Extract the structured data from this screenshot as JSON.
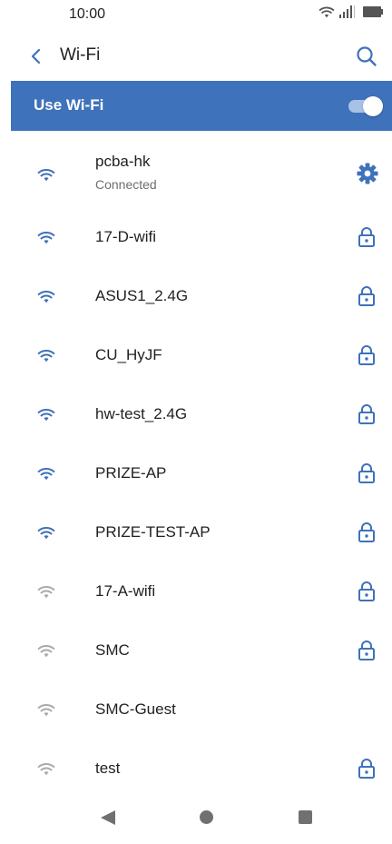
{
  "status_bar": {
    "time": "10:00"
  },
  "app_bar": {
    "title": "Wi-Fi",
    "back_icon": "back-arrow-icon",
    "search_icon": "search-icon"
  },
  "wifi_master": {
    "label": "Use Wi-Fi",
    "enabled": true,
    "bar_color": "#3e72bb"
  },
  "networks": [
    {
      "ssid": "pcba-hk",
      "status": "Connected",
      "signal": "strong",
      "trailing_icon": "gear-icon"
    },
    {
      "ssid": "17-D-wifi",
      "status": "",
      "signal": "strong",
      "trailing_icon": "lock-icon"
    },
    {
      "ssid": "ASUS1_2.4G",
      "status": "",
      "signal": "strong",
      "trailing_icon": "lock-icon"
    },
    {
      "ssid": "CU_HyJF",
      "status": "",
      "signal": "strong",
      "trailing_icon": "lock-icon"
    },
    {
      "ssid": "hw-test_2.4G",
      "status": "",
      "signal": "strong",
      "trailing_icon": "lock-icon"
    },
    {
      "ssid": "PRIZE-AP",
      "status": "",
      "signal": "strong",
      "trailing_icon": "lock-icon"
    },
    {
      "ssid": "PRIZE-TEST-AP",
      "status": "",
      "signal": "strong",
      "trailing_icon": "lock-icon"
    },
    {
      "ssid": "17-A-wifi",
      "status": "",
      "signal": "weak",
      "trailing_icon": "lock-icon"
    },
    {
      "ssid": "SMC",
      "status": "",
      "signal": "weak",
      "trailing_icon": "lock-icon"
    },
    {
      "ssid": "SMC-Guest",
      "status": "",
      "signal": "weak",
      "trailing_icon": ""
    },
    {
      "ssid": "test",
      "status": "",
      "signal": "weak",
      "trailing_icon": "lock-icon"
    }
  ],
  "colors": {
    "accent": "#3e72bb",
    "wifi_strong": "#3f6fb5",
    "wifi_weak": "#a9a9a9",
    "text_primary": "#202124",
    "text_secondary": "#6b6f73"
  }
}
